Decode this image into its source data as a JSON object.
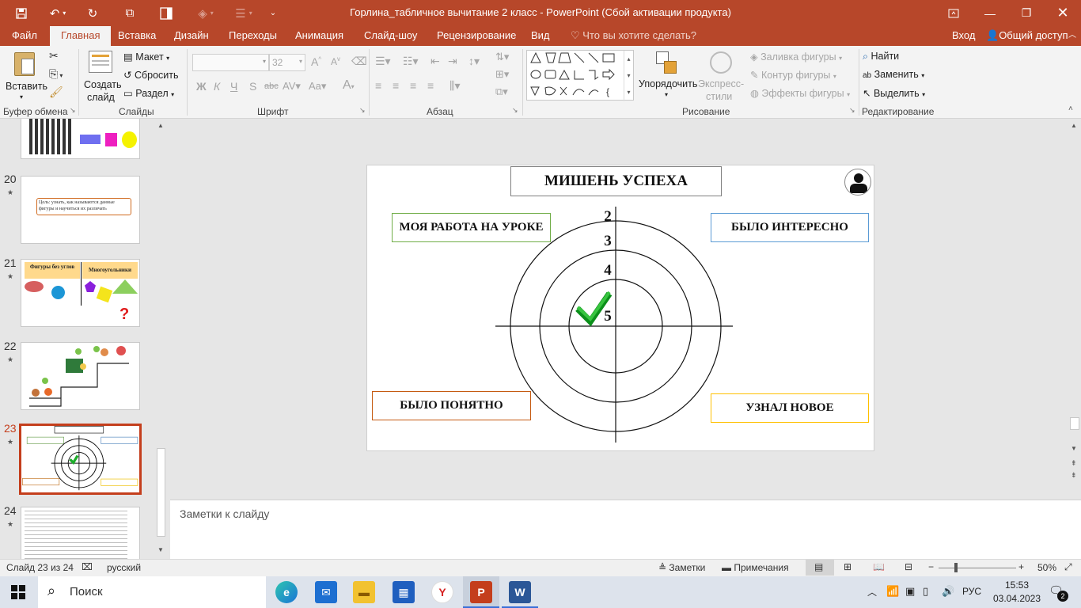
{
  "app": {
    "window_title": "Горлина_табличное вычитание 2 класс - PowerPoint (Сбой активации продукта)"
  },
  "tabs": [
    "Файл",
    "Главная",
    "Вставка",
    "Дизайн",
    "Переходы",
    "Анимация",
    "Слайд-шоу",
    "Рецензирование",
    "Вид"
  ],
  "tell_me": "Что вы хотите сделать?",
  "account": {
    "login": "Вход",
    "share": "Общий доступ"
  },
  "ribbon": {
    "clipboard": {
      "paste": "Вставить",
      "label": "Буфер обмена"
    },
    "slides": {
      "new_slide_1": "Создать",
      "new_slide_2": "слайд",
      "layout": "Макет",
      "reset": "Сбросить",
      "section": "Раздел",
      "label": "Слайды"
    },
    "font": {
      "size": "32",
      "bold": "Ж",
      "italic": "К",
      "underline": "Ч",
      "strike": "S",
      "label": "Шрифт"
    },
    "paragraph": {
      "label": "Абзац"
    },
    "drawing": {
      "arrange": "Упорядочить",
      "styles_1": "Экспресс-",
      "styles_2": "стили",
      "fill": "Заливка фигуры",
      "outline": "Контур фигуры",
      "effects": "Эффекты фигуры",
      "label": "Рисование"
    },
    "editing": {
      "find": "Найти",
      "replace": "Заменить",
      "select": "Выделить",
      "label": "Редактирование"
    }
  },
  "thumbnails": [
    {
      "num": "20",
      "text": "Цель: узнать, как называются данные фигуры и научиться их различать"
    },
    {
      "num": "21",
      "left_title": "Фигуры без углов",
      "right_title": "Многоугольники"
    },
    {
      "num": "22"
    },
    {
      "num": "23"
    },
    {
      "num": "24"
    }
  ],
  "slide": {
    "title": "МИШЕНЬ УСПЕХА",
    "box_top_left": "МОЯ РАБОТА НА УРОКЕ",
    "box_top_right": "БЫЛО ИНТЕРЕСНО",
    "box_bottom_left": "БЫЛО ПОНЯТНО",
    "box_bottom_right": "УЗНАЛ НОВОЕ",
    "ring_labels": [
      "2",
      "3",
      "4",
      "5"
    ]
  },
  "notes_placeholder": "Заметки к слайду",
  "status": {
    "slide_counter": "Слайд 23 из 24",
    "language": "русский",
    "notes": "Заметки",
    "comments": "Примечания",
    "zoom": "50%"
  },
  "taskbar": {
    "search": "Поиск",
    "lang": "РУС",
    "time": "15:53",
    "date": "03.04.2023",
    "notif_count": "2"
  }
}
